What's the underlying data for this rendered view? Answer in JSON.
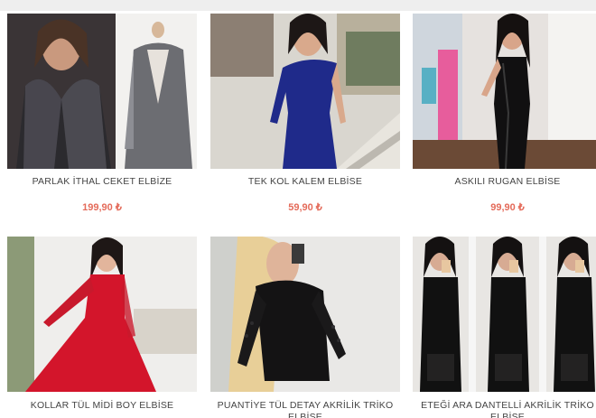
{
  "products": [
    {
      "name": "PARLAK İTHAL CEKET ELBİZE",
      "price": "199,90 ₺"
    },
    {
      "name": "TEK KOL KALEM ELBİSE",
      "price": "59,90 ₺"
    },
    {
      "name": "ASKILI RUGAN ELBİSE",
      "price": "99,90 ₺"
    },
    {
      "name": "KOLLAR TÜL MİDİ BOY ELBİSE",
      "price": ""
    },
    {
      "name": "PUANTİYE TÜL DETAY AKRİLİK TRİKO ELBİSE",
      "price": ""
    },
    {
      "name": "ETEĞİ ARA DANTELLİ AKRİLİK TRİKO ELBİSE",
      "price": ""
    }
  ],
  "colors": {
    "price": "#e46b5a",
    "name": "#444444",
    "top_bar": "#eeeeee"
  }
}
